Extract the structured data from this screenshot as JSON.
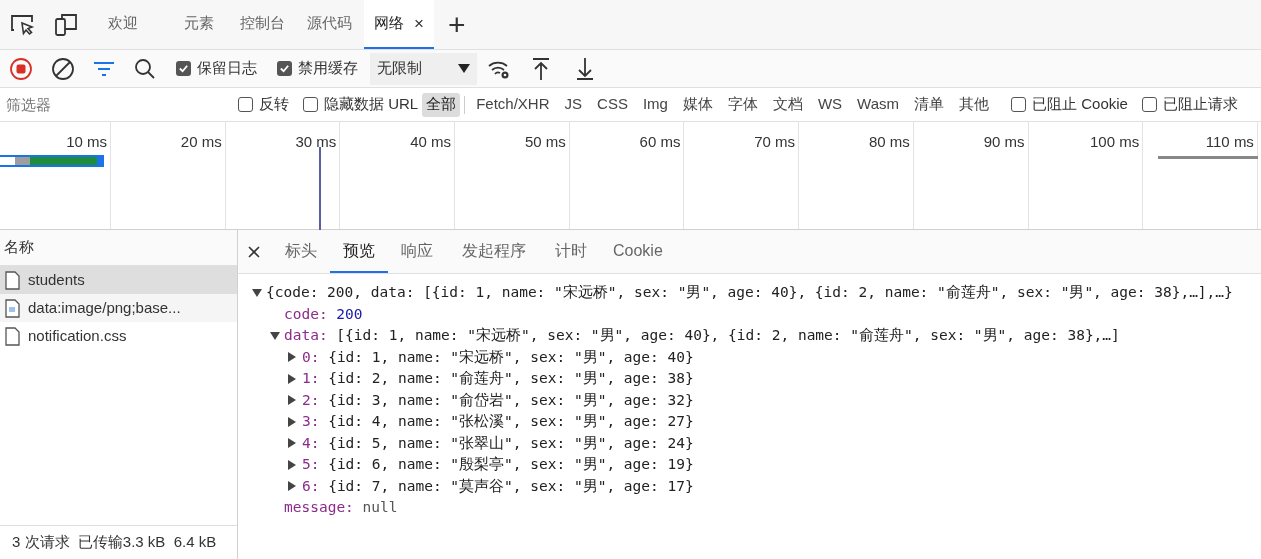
{
  "main_tabs": [
    {
      "label": "欢迎",
      "selected": false
    },
    {
      "label": "元素",
      "selected": false
    },
    {
      "label": "控制台",
      "selected": false
    },
    {
      "label": "源代码",
      "selected": false
    },
    {
      "label": "网络",
      "selected": true,
      "close": "×"
    }
  ],
  "add_tab": "+",
  "toolbar": {
    "recording": true,
    "preserve_log": {
      "label": "保留日志",
      "checked": true
    },
    "disable_cache": {
      "label": "禁用缓存",
      "checked": true
    },
    "throttling": "无限制"
  },
  "filter": {
    "placeholder": "筛选器",
    "invert": {
      "label": "反转",
      "checked": false
    },
    "hide_data_urls": {
      "label": "隐藏数据 URL",
      "checked": false
    },
    "types": [
      {
        "label": "全部",
        "selected": true
      },
      {
        "label": "Fetch/XHR",
        "selected": false
      },
      {
        "label": "JS",
        "selected": false
      },
      {
        "label": "CSS",
        "selected": false
      },
      {
        "label": "Img",
        "selected": false
      },
      {
        "label": "媒体",
        "selected": false
      },
      {
        "label": "字体",
        "selected": false
      },
      {
        "label": "文档",
        "selected": false
      },
      {
        "label": "WS",
        "selected": false
      },
      {
        "label": "Wasm",
        "selected": false
      },
      {
        "label": "清单",
        "selected": false
      },
      {
        "label": "其他",
        "selected": false
      }
    ],
    "blocked_cookies": {
      "label": "已阻止 Cookie",
      "checked": false
    },
    "blocked_requests": {
      "label": "已阻止请求",
      "checked": false
    }
  },
  "timeline": {
    "ticks": [
      "10 ms",
      "20 ms",
      "30 ms",
      "40 ms",
      "50 ms",
      "60 ms",
      "70 ms",
      "80 ms",
      "90 ms",
      "100 ms",
      "110 ms"
    ]
  },
  "requests": {
    "header": "名称",
    "items": [
      {
        "name": "students",
        "kind": "document",
        "selected": true
      },
      {
        "name": "data:image/png;base...",
        "kind": "image",
        "selected": false
      },
      {
        "name": "notification.css",
        "kind": "document",
        "selected": false
      }
    ]
  },
  "status_bar": "3 次请求  已传输3.3 kB  6.4 kB",
  "detail_tabs": [
    {
      "label": "标头",
      "selected": false
    },
    {
      "label": "预览",
      "selected": true
    },
    {
      "label": "响应",
      "selected": false
    },
    {
      "label": "发起程序",
      "selected": false
    },
    {
      "label": "计时",
      "selected": false
    },
    {
      "label": "Cookie",
      "selected": false
    }
  ],
  "preview": {
    "summary": "{code: 200, data: [{id: 1, name: \"宋远桥\", sex: \"男\", age: 40}, {id: 2, name: \"俞莲舟\", sex: \"男\", age: 38},…],…}",
    "expanded": true,
    "children": [
      {
        "key": "code:",
        "value": "200",
        "kind": "number"
      },
      {
        "key": "data:",
        "summary": "[{id: 1, name: \"宋远桥\", sex: \"男\", age: 40}, {id: 2, name: \"俞莲舟\", sex: \"男\", age: 38},…]",
        "expanded": true,
        "children": [
          {
            "key": "0:",
            "summary": "{id: 1, name: \"宋远桥\", sex: \"男\", age: 40}",
            "expanded": false
          },
          {
            "key": "1:",
            "summary": "{id: 2, name: \"俞莲舟\", sex: \"男\", age: 38}",
            "expanded": false
          },
          {
            "key": "2:",
            "summary": "{id: 3, name: \"俞岱岩\", sex: \"男\", age: 32}",
            "expanded": false
          },
          {
            "key": "3:",
            "summary": "{id: 4, name: \"张松溪\", sex: \"男\", age: 27}",
            "expanded": false
          },
          {
            "key": "4:",
            "summary": "{id: 5, name: \"张翠山\", sex: \"男\", age: 24}",
            "expanded": false
          },
          {
            "key": "5:",
            "summary": "{id: 6, name: \"殷梨亭\", sex: \"男\", age: 19}",
            "expanded": false
          },
          {
            "key": "6:",
            "summary": "{id: 7, name: \"莫声谷\", sex: \"男\", age: 17}",
            "expanded": false
          }
        ]
      },
      {
        "key": "message:",
        "value": "null",
        "kind": "null"
      }
    ]
  }
}
